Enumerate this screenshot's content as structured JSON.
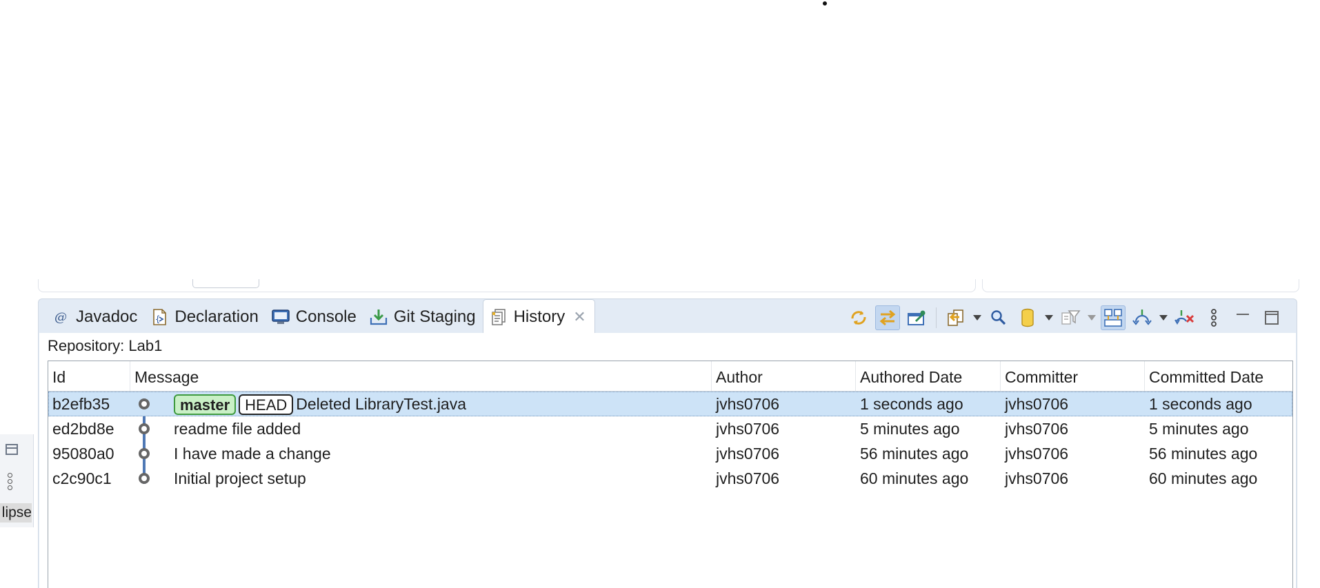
{
  "sidebar": {
    "cut_label": "lipse"
  },
  "tabs": [
    {
      "label": "Javadoc",
      "icon": "at-sign-icon"
    },
    {
      "label": "Declaration",
      "icon": "declaration-icon"
    },
    {
      "label": "Console",
      "icon": "console-monitor-icon"
    },
    {
      "label": "Git Staging",
      "icon": "git-staging-icon"
    },
    {
      "label": "History",
      "icon": "history-icon",
      "active": true
    }
  ],
  "history": {
    "repository_label": "Repository: Lab1",
    "columns": [
      "Id",
      "Message",
      "Author",
      "Authored Date",
      "Committer",
      "Committed Date"
    ],
    "rows": [
      {
        "id": "b2efb35",
        "refs": [
          "master",
          "HEAD"
        ],
        "message": "Deleted LibraryTest.java",
        "author": "jvhs0706",
        "authored": "1 seconds ago",
        "committer": "jvhs0706",
        "committed": "1 seconds ago"
      },
      {
        "id": "ed2bd8e",
        "refs": [],
        "message": "readme file added",
        "author": "jvhs0706",
        "authored": "5 minutes ago",
        "committer": "jvhs0706",
        "committed": "5 minutes ago"
      },
      {
        "id": "95080a0",
        "refs": [],
        "message": "I have made a change",
        "author": "jvhs0706",
        "authored": "56 minutes ago",
        "committer": "jvhs0706",
        "committed": "56 minutes ago"
      },
      {
        "id": "c2c90c1",
        "refs": [],
        "message": "Initial project setup",
        "author": "jvhs0706",
        "authored": "60 minutes ago",
        "committer": "jvhs0706",
        "committed": "60 minutes ago"
      }
    ]
  },
  "colors": {
    "panel": "#e3ebf5",
    "selection": "#cde3f7",
    "branch_ref": "#c9f0c6",
    "graph_line": "#4f79b5"
  }
}
